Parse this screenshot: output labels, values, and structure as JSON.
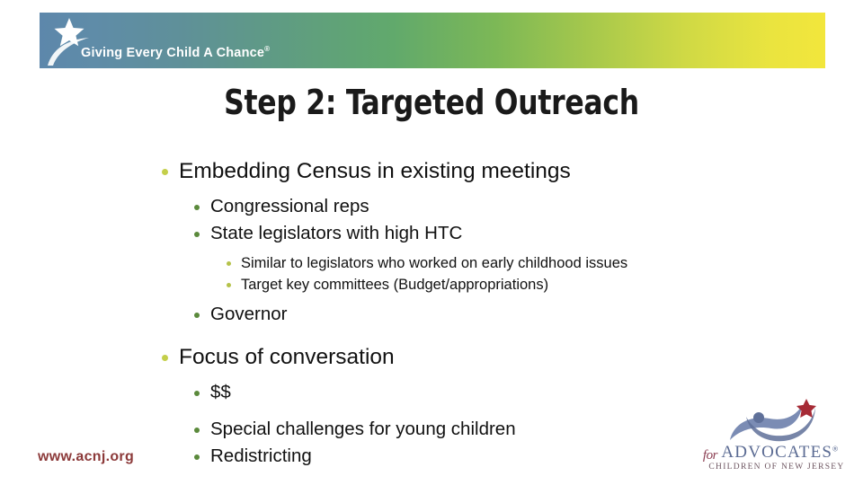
{
  "header": {
    "tagline": "Giving Every Child A Chance",
    "tagline_mark": "®",
    "star_icon": "star-icon",
    "swoosh_icon": "swoosh-icon",
    "gradient_start": "#5d87ab",
    "gradient_mid": "#61a96c",
    "gradient_end": "#f2e63c"
  },
  "title": "Step 2: Targeted Outreach",
  "bullets": {
    "level1_color": "#c4cf4a",
    "level2_color": "#5b8a3c",
    "level3_color": "#b5c24a",
    "items": [
      {
        "level": 1,
        "text": "Embedding Census in existing meetings"
      },
      {
        "level": 2,
        "text": "Congressional reps"
      },
      {
        "level": 2,
        "text": "State legislators with high HTC"
      },
      {
        "level": 3,
        "text": "Similar to legislators who worked on early childhood issues"
      },
      {
        "level": 3,
        "text": "Target key committees (Budget/appropriations)"
      },
      {
        "level": 2,
        "text": "Governor"
      },
      {
        "level": 1,
        "text": "Focus of conversation"
      },
      {
        "level": 2,
        "text": "$$"
      },
      {
        "level": 2,
        "text": "Special challenges for young children"
      },
      {
        "level": 2,
        "text": "Redistricting"
      }
    ]
  },
  "footer": {
    "url": "www.acnj.org",
    "url_color": "#8c3a3a",
    "logo": {
      "for_text": "for",
      "name": "ADVOCATES",
      "registered_mark": "®",
      "subtitle": "CHILDREN OF NEW JERSEY",
      "figure_icon": "person-swoosh-icon",
      "star_icon": "red-star-icon",
      "figure_color": "#7b8cb4",
      "star_color": "#a62b36"
    }
  }
}
